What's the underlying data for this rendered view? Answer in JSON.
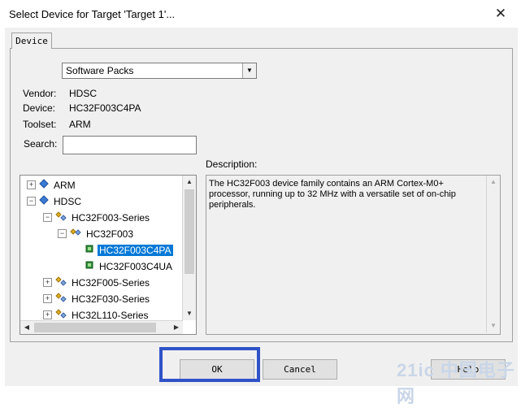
{
  "window": {
    "title": "Select Device for Target 'Target 1'...",
    "close_glyph": "✕"
  },
  "tabs": [
    {
      "label": "Device"
    }
  ],
  "source_select": {
    "value": "Software Packs"
  },
  "info": {
    "vendor_label": "Vendor:",
    "vendor": "HDSC",
    "device_label": "Device:",
    "device": "HC32F003C4PA",
    "toolset_label": "Toolset:",
    "toolset": "ARM",
    "search_label": "Search:",
    "search_value": ""
  },
  "tree": {
    "items": [
      {
        "label": "ARM",
        "level": 0,
        "expander": "+",
        "icon": "vendor-diamond-icon"
      },
      {
        "label": "HDSC",
        "level": 0,
        "expander": "−",
        "icon": "vendor-diamond-icon"
      },
      {
        "label": "HC32F003-Series",
        "level": 1,
        "expander": "−",
        "icon": "family-icon"
      },
      {
        "label": "HC32F003",
        "level": 2,
        "expander": "−",
        "icon": "subfamily-icon"
      },
      {
        "label": "HC32F003C4PA",
        "level": 3,
        "expander": "",
        "icon": "chip-icon",
        "selected": true
      },
      {
        "label": "HC32F003C4UA",
        "level": 3,
        "expander": "",
        "icon": "chip-icon"
      },
      {
        "label": "HC32F005-Series",
        "level": 1,
        "expander": "+",
        "icon": "family-icon"
      },
      {
        "label": "HC32F030-Series",
        "level": 1,
        "expander": "+",
        "icon": "family-icon"
      },
      {
        "label": "HC32L110-Series",
        "level": 1,
        "expander": "+",
        "icon": "family-icon"
      }
    ]
  },
  "description": {
    "label": "Description:",
    "text": "The HC32F003 device family contains an ARM Cortex-M0+ processor, running up to 32 MHz with a versatile set of on-chip peripherals."
  },
  "buttons": {
    "ok": "OK",
    "cancel": "Cancel",
    "help": "Help"
  },
  "watermark": "21ic 中国电子网",
  "colors": {
    "selection": "#0078d7",
    "highlight_box": "#2f52c8",
    "dialog_bg": "#f0f0f0"
  }
}
